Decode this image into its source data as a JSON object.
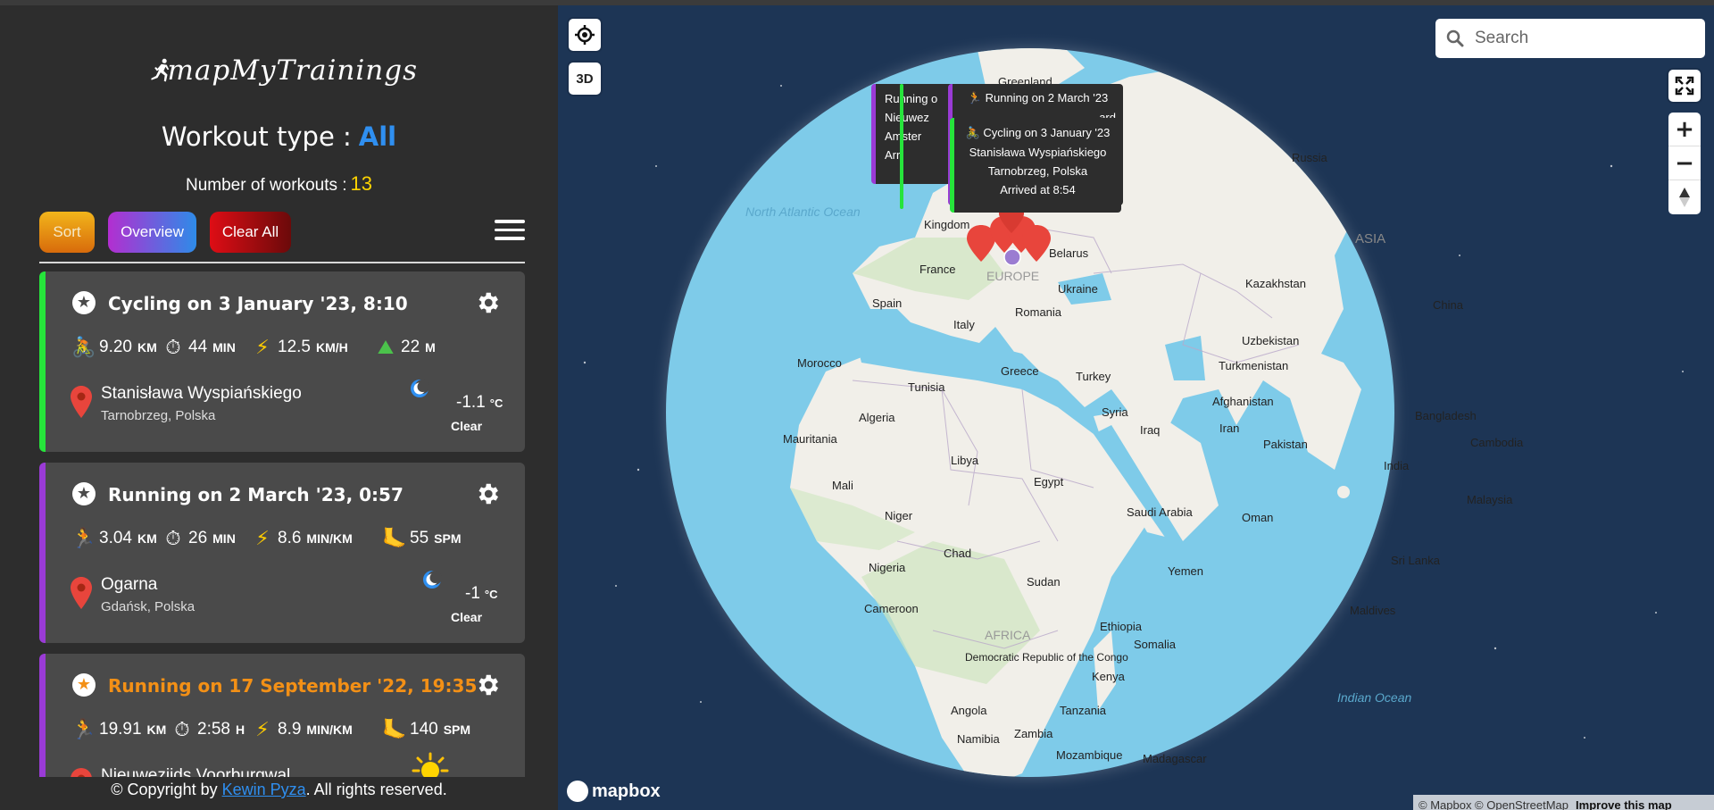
{
  "app": {
    "logo_text": "mapMyTrainings",
    "workout_type_label": "Workout type :",
    "workout_type_value": "All",
    "count_label": "Number of workouts :",
    "count_value": "13"
  },
  "toolbar": {
    "sort_label": "Sort",
    "overview_label": "Overview",
    "clear_label": "Clear All"
  },
  "workouts": [
    {
      "type": "cycling",
      "title": "Cycling on 3 January '23, 8:10",
      "favorite": false,
      "accent": "#26e43b",
      "stats": [
        {
          "icon": "bicycle-icon",
          "value": "9.20",
          "unit": "KM"
        },
        {
          "icon": "stopwatch-icon",
          "value": "44",
          "unit": "MIN"
        },
        {
          "icon": "lightning-icon",
          "value": "12.5",
          "unit": "KM/H"
        },
        {
          "icon": "elevation-icon",
          "value": "22",
          "unit": "M"
        }
      ],
      "place": "Stanisława Wyspiańskiego",
      "city": "Tarnobrzeg, Polska",
      "weather_icon": "moon-icon",
      "temp": "-1.1",
      "temp_unit": "°C",
      "weather": "Clear"
    },
    {
      "type": "running",
      "title": "Running on 2 March '23, 0:57",
      "favorite": false,
      "accent": "#9a3bd6",
      "stats": [
        {
          "icon": "runner-icon",
          "value": "3.04",
          "unit": "KM"
        },
        {
          "icon": "stopwatch-icon",
          "value": "26",
          "unit": "MIN"
        },
        {
          "icon": "lightning-icon",
          "value": "8.6",
          "unit": "MIN/KM"
        },
        {
          "icon": "foot-icon",
          "value": "55",
          "unit": "SPM"
        }
      ],
      "place": "Ogarna",
      "city": "Gdańsk, Polska",
      "weather_icon": "moon-icon",
      "temp": "-1",
      "temp_unit": "°C",
      "weather": "Clear"
    },
    {
      "type": "running",
      "title": "Running on 17 September '22, 19:35",
      "favorite": true,
      "accent": "#9a3bd6",
      "stats": [
        {
          "icon": "runner-icon",
          "value": "19.91",
          "unit": "KM"
        },
        {
          "icon": "stopwatch-icon",
          "value": "2:58",
          "unit": "H"
        },
        {
          "icon": "lightning-icon",
          "value": "8.9",
          "unit": "MIN/KM"
        },
        {
          "icon": "foot-icon",
          "value": "140",
          "unit": "SPM"
        }
      ],
      "place": "Nieuwezijds Voorburgwal",
      "city": "",
      "weather_icon": "sun-icon",
      "temp": "",
      "temp_unit": "",
      "weather": ""
    }
  ],
  "footer": {
    "prefix": "© Copyright by ",
    "author": "Kewin Pyza",
    "suffix": ". All rights reserved."
  },
  "map": {
    "locate_label": "",
    "mode_label": "3D",
    "search_placeholder": "Search",
    "zoom_in": "+",
    "zoom_out": "−",
    "mapbox_label": "mapbox",
    "attribution": "© Mapbox © OpenStreetMap",
    "improve_label": "Improve this map",
    "ocean_color": "#7ecbe9",
    "land_color": "#f1efe9",
    "space_color": "#1d3555",
    "labels": {
      "greenland": "Greenland",
      "north_atlantic": "North Atlantic Ocean",
      "kingdom": "Kingdom",
      "france": "France",
      "spain": "Spain",
      "europe": "EUROPE",
      "belarus": "Belarus",
      "ukraine": "Ukraine",
      "russia": "Russia",
      "asia": "ASIA",
      "kazakhstan": "Kazakhstan",
      "china": "China",
      "uzbekistan": "Uzbekistan",
      "turkmenistan": "Turkmenistan",
      "italy": "Italy",
      "romania": "Romania",
      "morocco": "Morocco",
      "tunisia": "Tunisia",
      "greece": "Greece",
      "turkey": "Turkey",
      "afghanistan": "Afghanistan",
      "bangladesh": "Bangladesh",
      "algeria": "Algeria",
      "syria": "Syria",
      "iraq": "Iraq",
      "iran": "Iran",
      "mauritania": "Mauritania",
      "libya": "Libya",
      "pakistan": "Pakistan",
      "cambodia": "Cambodia",
      "mali": "Mali",
      "egypt": "Egypt",
      "india": "India",
      "niger": "Niger",
      "saudi": "Saudi Arabia",
      "oman": "Oman",
      "malaysia": "Malaysia",
      "chad": "Chad",
      "nigeria": "Nigeria",
      "yemen": "Yemen",
      "sudan": "Sudan",
      "srilanka": "Sri Lanka",
      "cameroon": "Cameroon",
      "africa": "AFRICA",
      "ethiopia": "Ethiopia",
      "maldives": "Maldives",
      "somalia": "Somalia",
      "drc": "Democratic Republic of the Congo",
      "kenya": "Kenya",
      "indian_ocean": "Indian Ocean",
      "angola": "Angola",
      "tanzania": "Tanzania",
      "zambia": "Zambia",
      "namibia": "Namibia",
      "mozambique": "Mozambique",
      "madagascar": "Madagascar"
    },
    "popups": {
      "back": [
        "Running o",
        "Nieuwez",
        "Amster",
        "Arri"
      ],
      "mid": [
        "Running on 2 March '23",
        "2"
      ],
      "front": [
        "Cycling on 3 January '23",
        "Stanisława Wyspiańskiego",
        "Tarnobrzeg, Polska",
        "Arrived at 8:54"
      ],
      "mid_extra": "ard"
    }
  }
}
